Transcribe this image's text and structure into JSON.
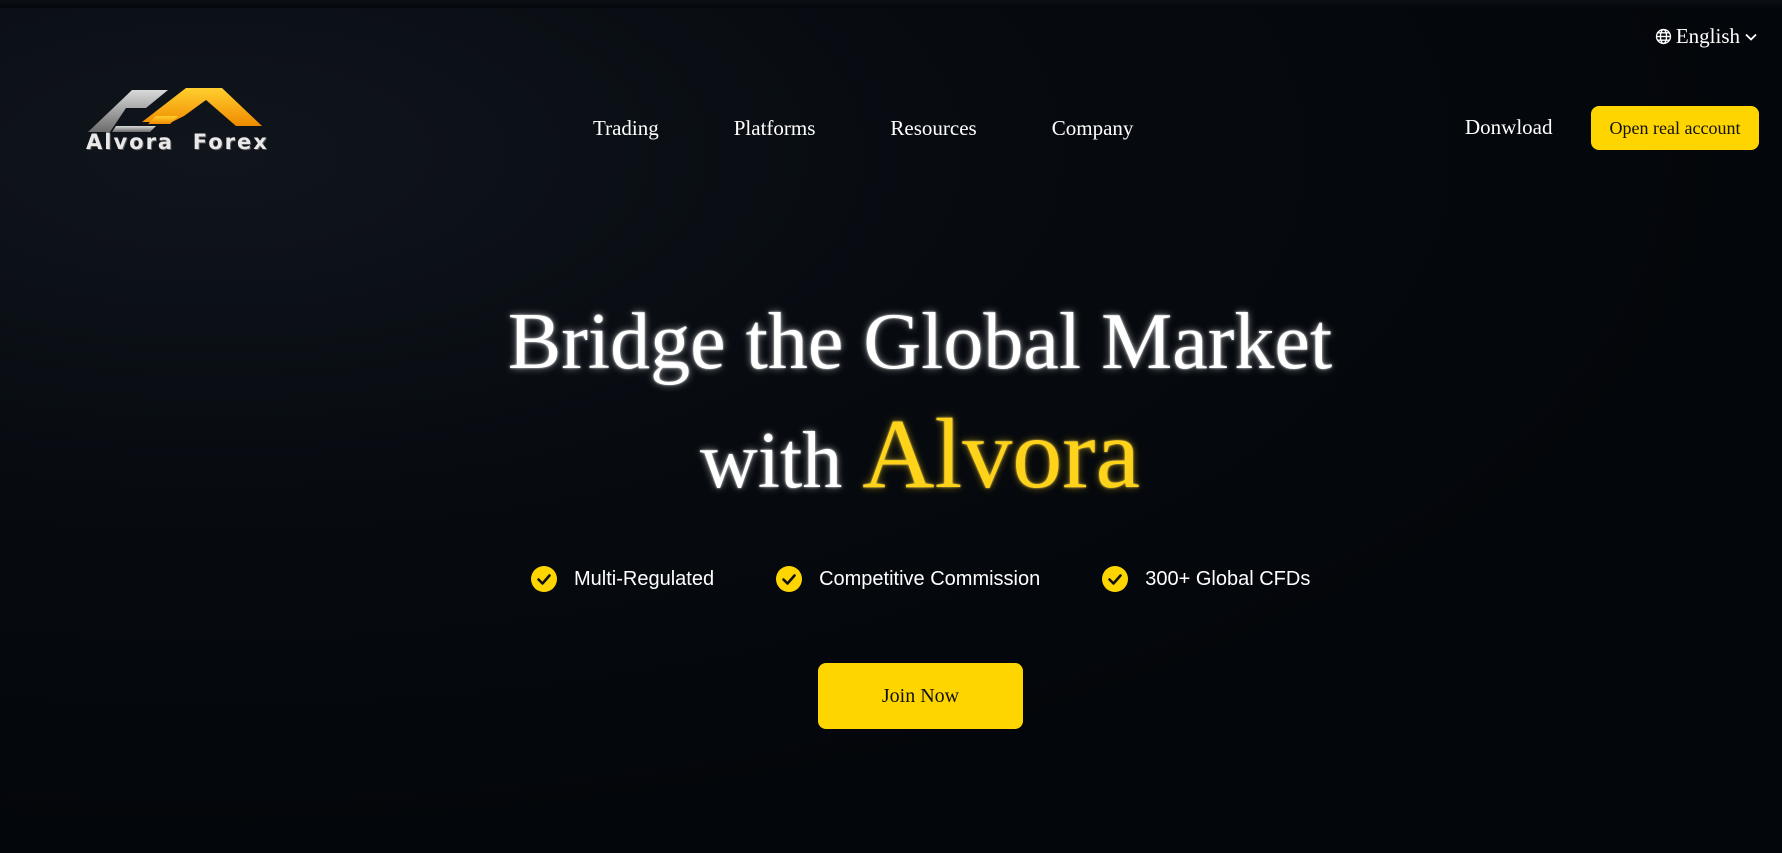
{
  "header": {
    "language_label": "English",
    "logo_text": "Alvora  Forex",
    "nav_items": [
      {
        "label": "Trading"
      },
      {
        "label": "Platforms"
      },
      {
        "label": "Resources"
      },
      {
        "label": "Company"
      }
    ],
    "download_label": "Donwload",
    "open_account_label": "Open real account"
  },
  "hero": {
    "title_line1": "Bridge the Global Market",
    "title_line2_prefix": "with",
    "title_line2_accent": "Alvora",
    "features": [
      {
        "label": "Multi-Regulated",
        "icon": "check-circle-icon"
      },
      {
        "label": "Competitive Commission",
        "icon": "check-circle-icon"
      },
      {
        "label": "300+ Global CFDs",
        "icon": "check-circle-icon"
      }
    ],
    "join_label": "Join Now"
  },
  "colors": {
    "background": "#03060a",
    "accent": "#ffd500",
    "text": "#ffffff"
  }
}
